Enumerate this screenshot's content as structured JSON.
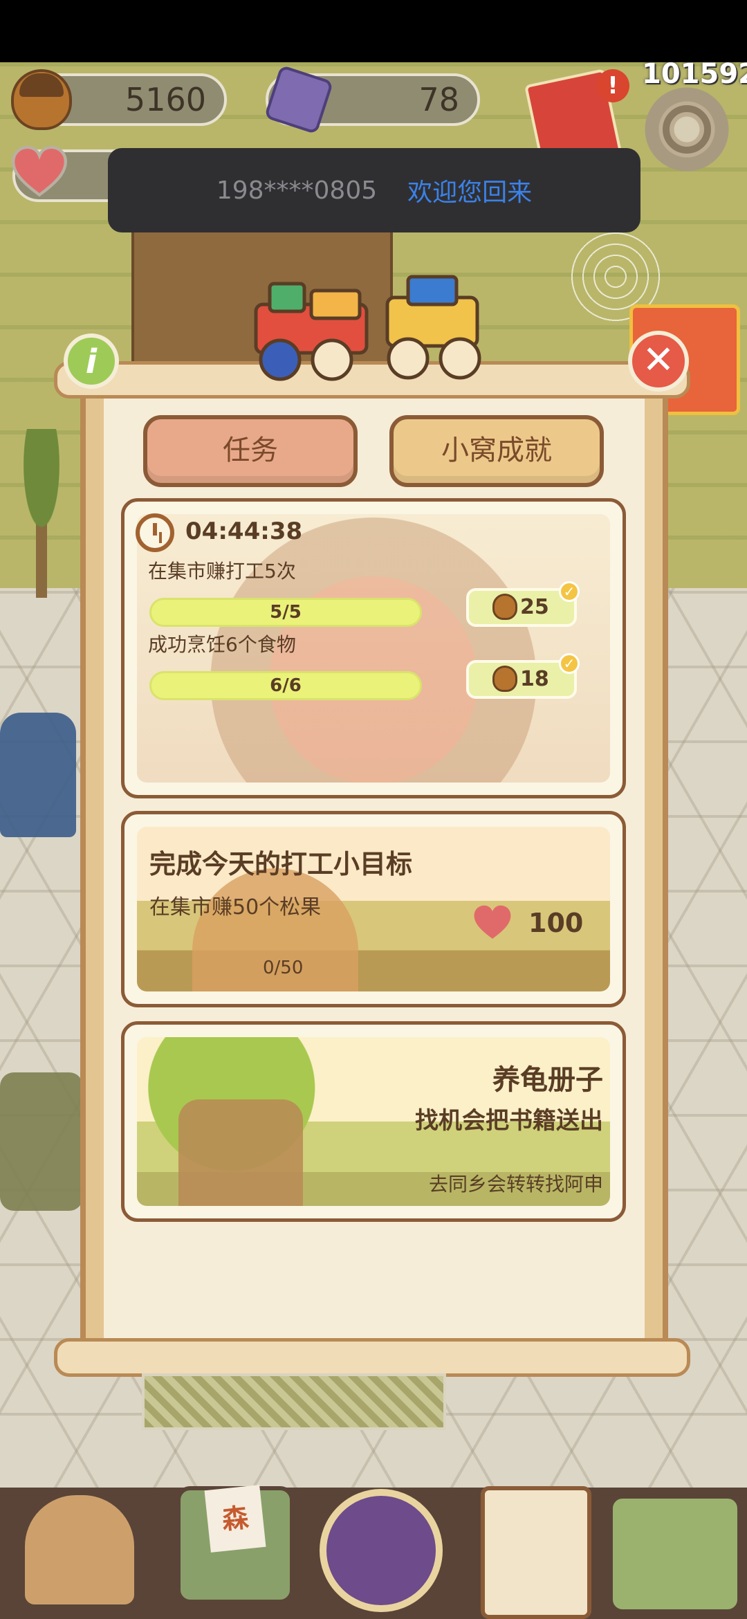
{
  "status": {
    "score": "101592"
  },
  "currency": {
    "acorns": "5160",
    "gems": "78"
  },
  "toast": {
    "phone": "198****0805",
    "message": "欢迎您回来"
  },
  "tabs": {
    "tasks": "任务",
    "achievements": "小窝成就"
  },
  "daily_tasks": {
    "timer": "04:44:38",
    "items": [
      {
        "label": "在集市赚打工5次",
        "progress": "5/5",
        "progress_fraction": 1.0,
        "reward": "25",
        "reward_icon": "acorn-icon",
        "claimed": true
      },
      {
        "label": "成功烹饪6个食物",
        "progress": "6/6",
        "progress_fraction": 1.0,
        "reward": "18",
        "reward_icon": "acorn-icon",
        "claimed": true
      }
    ]
  },
  "goal_card": {
    "title": "完成今天的打工小目标",
    "subtitle": "在集市赚50个松果",
    "progress": "0/50",
    "progress_fraction": 0.0,
    "reward": "100",
    "reward_icon": "heart-icon"
  },
  "story_card": {
    "title": "养龟册子",
    "subtitle": "找机会把书籍送出",
    "hint": "去同乡会转转找阿申"
  },
  "colors": {
    "panel_border": "#8b5b37",
    "tab_active": "#e8a98a",
    "tab_idle": "#ecc98a",
    "progress_fill": "#eaf27a",
    "toast_link": "#3b82e8"
  },
  "nav_icons": [
    "home-icon",
    "mail-icon",
    "egg-icon",
    "clipboard-icon",
    "map-icon"
  ]
}
